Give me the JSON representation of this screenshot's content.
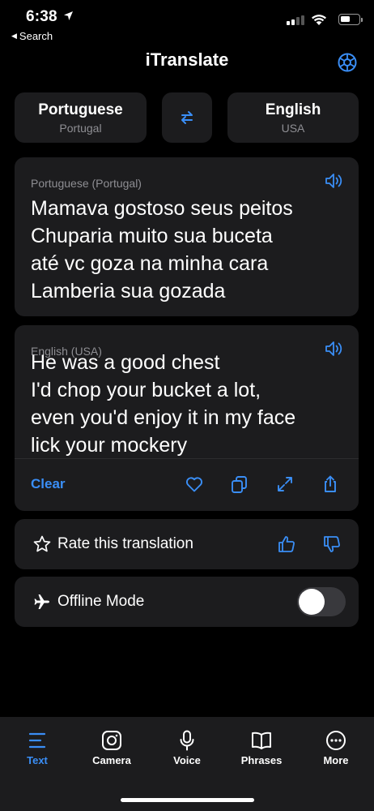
{
  "status_bar": {
    "time": "6:38",
    "back_label": "Search",
    "back_icon": "back-triangle",
    "location_icon": "location-arrow-icon",
    "signal_icon": "cellular-signal-icon",
    "wifi_icon": "wifi-icon",
    "battery_icon": "battery-icon"
  },
  "header": {
    "title": "iTranslate",
    "settings_icon": "gear-icon"
  },
  "languages": {
    "source": {
      "name": "Portuguese",
      "region": "Portugal"
    },
    "target": {
      "name": "English",
      "region": "USA"
    },
    "swap_icon": "swap-arrows-icon"
  },
  "source_card": {
    "label": "Portuguese (Portugal)",
    "lines": [
      "Mamava gostoso seus peitos",
      "Chuparia muito sua buceta",
      "até vc goza na minha cara",
      "Lamberia sua gozada"
    ],
    "speaker_icon": "speaker-icon"
  },
  "target_card": {
    "label": "English (USA)",
    "lines": [
      "He was a good chest",
      "I'd chop your bucket a lot,",
      "even you'd enjoy it in my face",
      "lick your mockery"
    ],
    "speaker_icon": "speaker-icon",
    "clear_label": "Clear",
    "actions": [
      "heart-icon",
      "copy-icon",
      "expand-icon",
      "share-icon"
    ]
  },
  "rate": {
    "label": "Rate this translation",
    "icon": "star-icon",
    "up_icon": "thumbs-up-icon",
    "down_icon": "thumbs-down-icon"
  },
  "offline": {
    "label": "Offline Mode",
    "icon": "airplane-icon",
    "enabled": false
  },
  "tabs": [
    {
      "label": "Text",
      "icon": "text-lines-icon",
      "active": true
    },
    {
      "label": "Camera",
      "icon": "camera-icon",
      "active": false
    },
    {
      "label": "Voice",
      "icon": "microphone-icon",
      "active": false
    },
    {
      "label": "Phrases",
      "icon": "book-icon",
      "active": false
    },
    {
      "label": "More",
      "icon": "more-dots-icon",
      "active": false
    }
  ],
  "colors": {
    "accent": "#3a8ef6",
    "background": "#000000",
    "card": "#1c1c1e",
    "secondary_text": "#8e8e93"
  }
}
